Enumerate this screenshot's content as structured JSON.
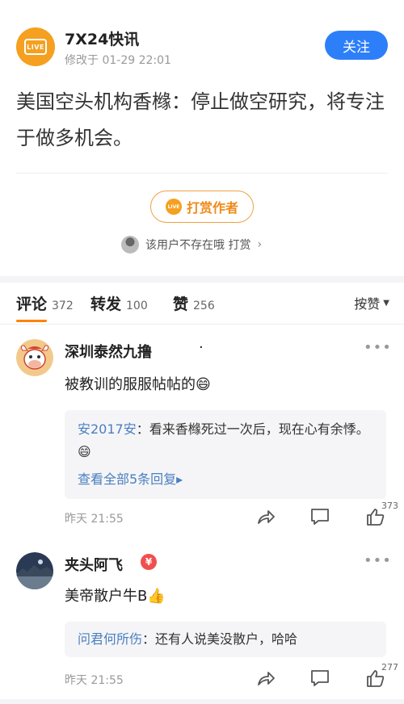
{
  "account": {
    "name": "7X24快讯",
    "meta": "修改于 01-29 22:01",
    "avatar_text": "LIVE",
    "follow_label": "关注"
  },
  "post": {
    "text": "美国空头机构香橼：停止做空研究，将专注于做多机会。"
  },
  "reward": {
    "button_label": "打赏作者",
    "icon_text": "LIVE",
    "rewarder_text": "该用户不存在哦 打赏",
    "chevron": "›"
  },
  "tabs": [
    {
      "label": "评论",
      "count": "372"
    },
    {
      "label": "转发",
      "count": "100"
    },
    {
      "label": "赞",
      "count": "256"
    }
  ],
  "sort": {
    "label": "按赞",
    "arrow": "▼"
  },
  "comments": [
    {
      "user": "深圳泰然九撸",
      "dot": "·",
      "text": "被教训的服服帖帖的😄",
      "more": "•••",
      "reply": {
        "user": "安2017安",
        "text": "：看来香橼死过一次后，现在心有余悸。😄",
        "view_all": "查看全部5条回复▸"
      },
      "time": "昨天 21:55",
      "likes": "373"
    },
    {
      "user": "夹头阿飞",
      "badge": "¥",
      "text": "美帝散户牛B👍",
      "more": "•••",
      "reply": {
        "user": "问君何所伤",
        "text": "：还有人说美没散户，哈哈"
      },
      "time": "昨天 21:55",
      "likes": "277"
    }
  ],
  "colors": {
    "accent_orange": "#ff8200",
    "follow_blue": "#2d7ff9",
    "link_blue": "#4a7fc0"
  }
}
